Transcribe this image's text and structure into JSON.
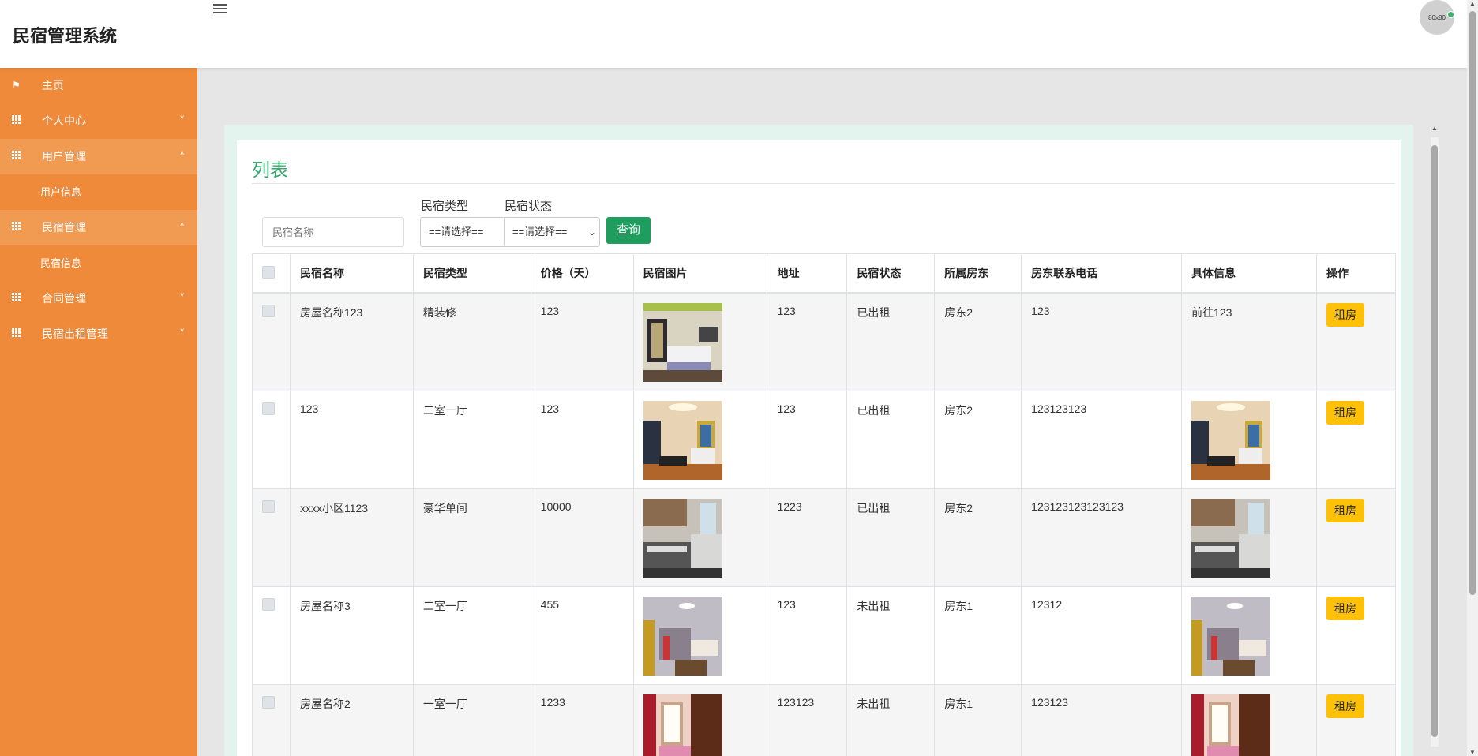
{
  "app": {
    "title": "民宿管理系统",
    "avatar_text": "80x80"
  },
  "sidebar": {
    "items": [
      {
        "label": "主页",
        "icon": "flag-icon",
        "caret": ""
      },
      {
        "label": "个人中心",
        "icon": "grid-icon",
        "caret": "˅"
      },
      {
        "label": "用户管理",
        "icon": "grid-icon",
        "caret": "˄",
        "sub": "用户信息"
      },
      {
        "label": "民宿管理",
        "icon": "grid-icon",
        "caret": "˄",
        "sub": "民宿信息"
      },
      {
        "label": "合同管理",
        "icon": "grid-icon",
        "caret": "˅"
      },
      {
        "label": "民宿出租管理",
        "icon": "grid-icon",
        "caret": "˅"
      }
    ]
  },
  "main": {
    "title": "列表",
    "filters": {
      "name_placeholder": "民宿名称",
      "type_label": "民宿类型",
      "type_value": "==请选择==",
      "status_label": "民宿状态",
      "status_value": "==请选择==",
      "query_label": "查询"
    },
    "table": {
      "columns": [
        "民宿名称",
        "民宿类型",
        "价格（天）",
        "民宿图片",
        "地址",
        "民宿状态",
        "所属房东",
        "房东联系电话",
        "具体信息",
        "操作"
      ],
      "action_label": "租房",
      "rows": [
        {
          "name": "房屋名称123",
          "type": "精装修",
          "price": "123",
          "address": "123",
          "status": "已出租",
          "landlord": "房东2",
          "phone": "123",
          "info": "前往123",
          "img": "bedroom",
          "info_img": ""
        },
        {
          "name": "123",
          "type": "二室一厅",
          "price": "123",
          "address": "123",
          "status": "已出租",
          "landlord": "房东2",
          "phone": "123123123",
          "info": "",
          "img": "living",
          "info_img": "living"
        },
        {
          "name": "xxxx小区1123",
          "type": "豪华单间",
          "price": "10000",
          "address": "1223",
          "status": "已出租",
          "landlord": "房东2",
          "phone": "123123123123123",
          "info": "",
          "img": "kitchen",
          "info_img": "kitchen"
        },
        {
          "name": "房屋名称3",
          "type": "二室一厅",
          "price": "455",
          "address": "123",
          "status": "未出租",
          "landlord": "房东1",
          "phone": "12312",
          "info": "",
          "img": "dining",
          "info_img": "dining"
        },
        {
          "name": "房屋名称2",
          "type": "一室一厅",
          "price": "1233",
          "address": "123123",
          "status": "未出租",
          "landlord": "房东1",
          "phone": "123123",
          "info": "",
          "img": "pink",
          "info_img": "pink"
        }
      ]
    }
  },
  "colors": {
    "sidebar": "#ef8a3a",
    "accent": "#2ea86b",
    "query_button": "#1f9d5f",
    "rent_button": "#ffc107"
  }
}
